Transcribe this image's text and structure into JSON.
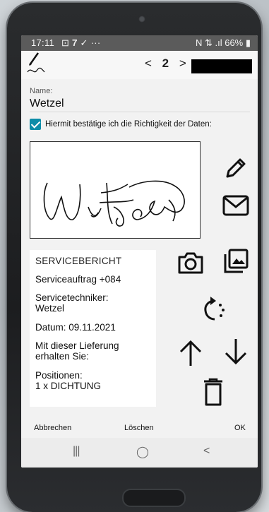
{
  "status": {
    "time": "17:11",
    "left_icons": "⊡ 𝟕 ✓ ···",
    "right": "N ⇅ .ıl 66% ▮"
  },
  "app": {
    "pager_prev": "<",
    "pager_num": "2",
    "pager_next": ">"
  },
  "form": {
    "name_label": "Name:",
    "name_value": "Wetzel",
    "confirm_text": "Hiermit bestätige ich die Richtigkeit der Daten:",
    "confirm_checked": true
  },
  "report": {
    "title": "SERVICEBERICHT",
    "order": "Serviceauftrag +084",
    "tech_label": "Servicetechniker:",
    "tech_name": "Wetzel",
    "date": "Datum: 09.11.2021",
    "delivery_1": "Mit dieser Lieferung",
    "delivery_2": "erhalten Sie:",
    "pos_label": "Positionen:",
    "pos_item": "1 x DICHTUNG"
  },
  "actions": {
    "cancel": "Abbrechen",
    "delete": "Löschen",
    "ok": "OK"
  },
  "nav": {
    "recent": "|||",
    "home": "◯",
    "back": "<"
  },
  "icons": [
    "pen-icon",
    "mail-icon",
    "camera-icon",
    "gallery-icon",
    "rotate-icon",
    "arrow-up-icon",
    "arrow-down-icon",
    "trash-icon"
  ],
  "colors": {
    "checkbox": "#0d8ca8",
    "status_bar": "#5b5b5b"
  }
}
